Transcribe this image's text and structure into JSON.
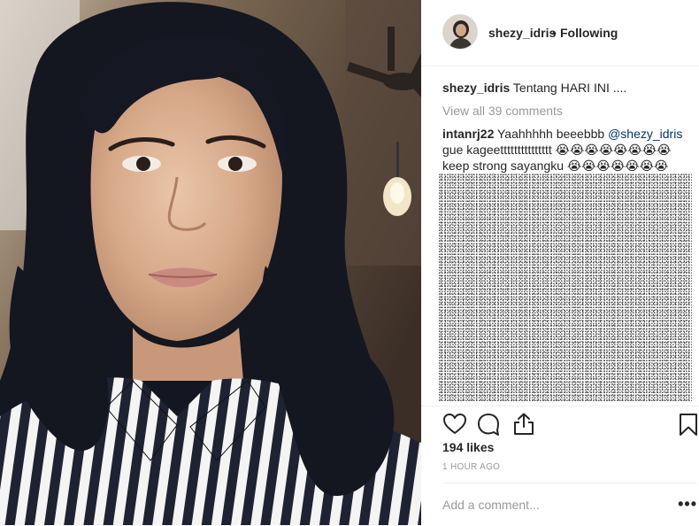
{
  "header": {
    "username": "shezy_idris",
    "separator": "•",
    "follow_status": "Following"
  },
  "caption": {
    "username": "shezy_idris",
    "text": " Tentang HARI INI ...."
  },
  "comments": {
    "view_all": "View all 39 comments",
    "first": {
      "username": "intanrj22",
      "text_before": " Yaahhhhh beeebbb ",
      "mention": "@shezy_idris",
      "line2": "gue kageettttttttttttttt 😭😭😭😭😭😭😭😭",
      "line3": "keep strong sayangku 😭😭😭😭😭😭😭"
    }
  },
  "actions": {
    "like_icon": "heart-icon",
    "comment_icon": "comment-icon",
    "share_icon": "share-icon",
    "save_icon": "bookmark-icon"
  },
  "likes": "194 likes",
  "time_ago": "1 HOUR AGO",
  "add_comment": {
    "placeholder": "Add a comment...",
    "more": "•••"
  },
  "colors": {
    "link": "#003569",
    "muted": "#999999",
    "text": "#262626",
    "divider": "#efefef"
  }
}
